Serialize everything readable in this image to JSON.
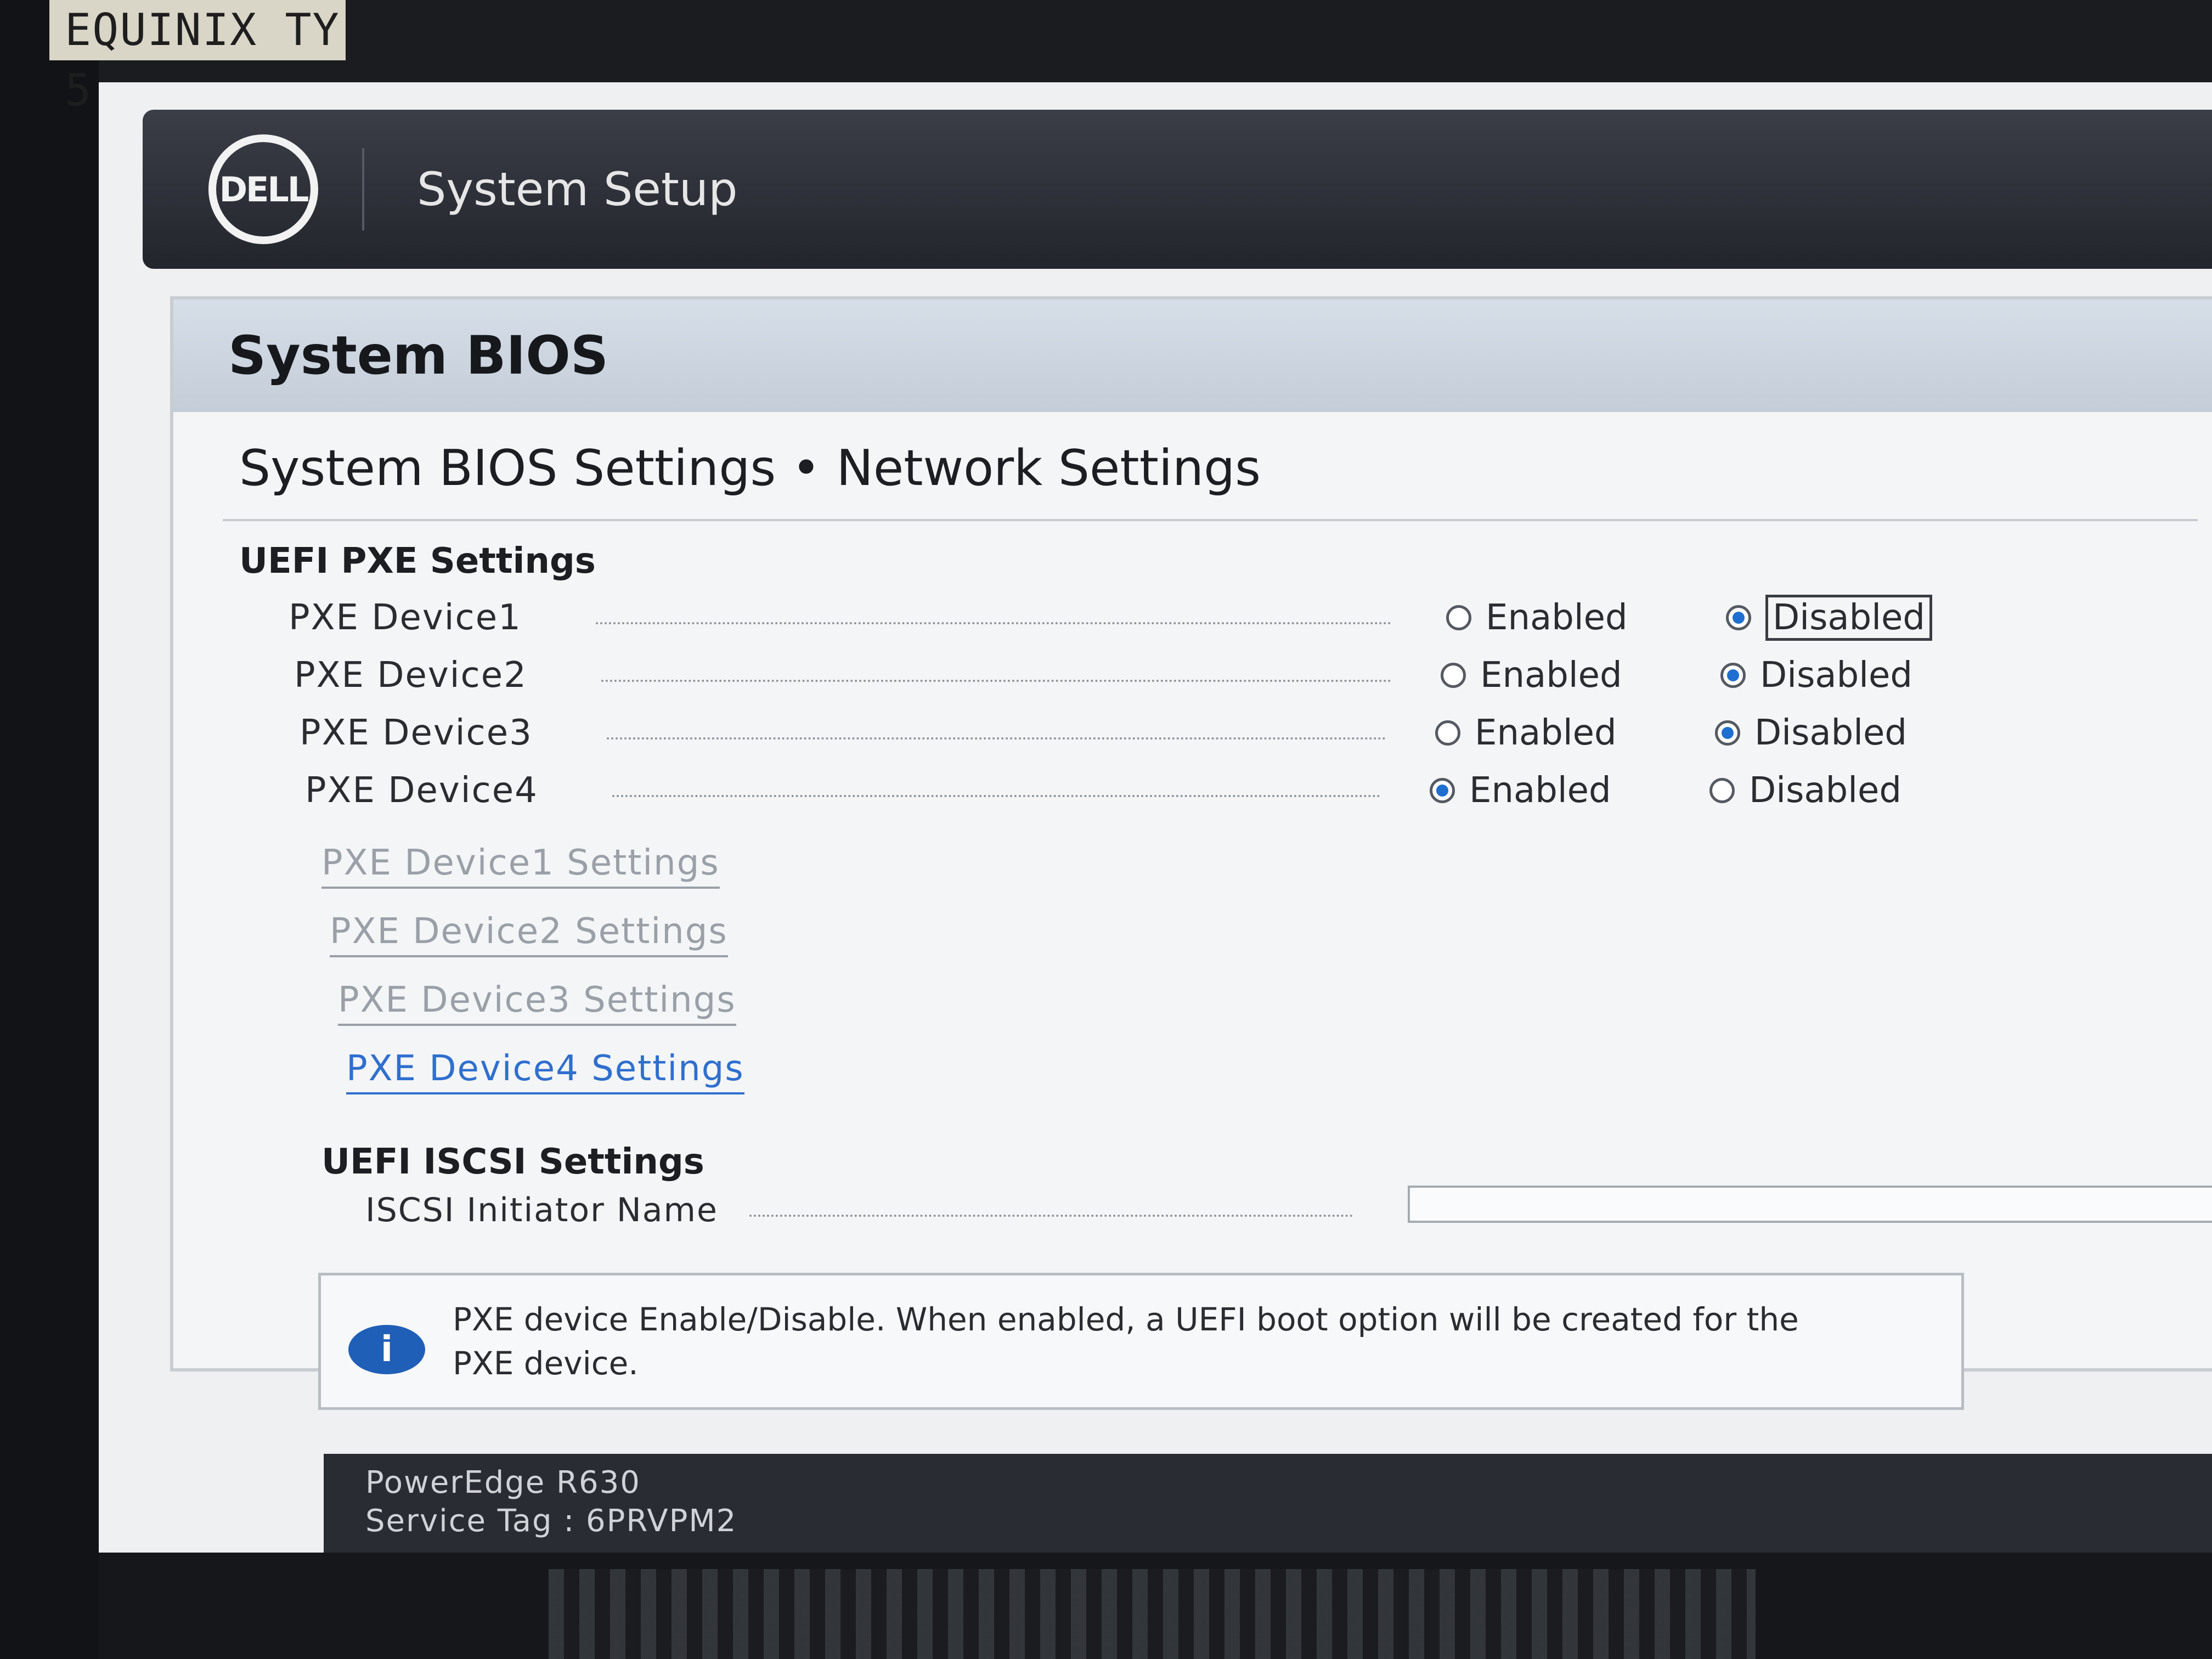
{
  "asset_label": "EQUINIX TY 5",
  "brand": {
    "logo_text": "DELL",
    "title": "System Setup"
  },
  "panel": {
    "header": "System BIOS",
    "breadcrumb": "System BIOS Settings • Network Settings"
  },
  "pxe": {
    "section_title": "UEFI PXE Settings",
    "devices": [
      {
        "label": "PXE Device1",
        "enabled_label": "Enabled",
        "disabled_label": "Disabled",
        "selected": "Disabled"
      },
      {
        "label": "PXE Device2",
        "enabled_label": "Enabled",
        "disabled_label": "Disabled",
        "selected": "Disabled"
      },
      {
        "label": "PXE Device3",
        "enabled_label": "Enabled",
        "disabled_label": "Disabled",
        "selected": "Disabled"
      },
      {
        "label": "PXE Device4",
        "enabled_label": "Enabled",
        "disabled_label": "Disabled",
        "selected": "Enabled"
      }
    ],
    "settings_links": [
      "PXE Device1 Settings",
      "PXE Device2 Settings",
      "PXE Device3 Settings",
      "PXE Device4 Settings"
    ]
  },
  "iscsi": {
    "section_title": "UEFI ISCSI Settings",
    "initiator_label": "ISCSI Initiator Name",
    "initiator_value": ""
  },
  "help": {
    "icon": "info-icon",
    "text_line1": "PXE device Enable/Disable. When enabled, a UEFI boot option will be created for the",
    "text_line2": "PXE device."
  },
  "footer": {
    "model": "PowerEdge R630",
    "service_tag": "Service Tag : 6PRVPM2"
  },
  "colors": {
    "accent_blue": "#1f6fd1",
    "brandbar": "#2b2e36",
    "header_band": "#cdd5df"
  }
}
